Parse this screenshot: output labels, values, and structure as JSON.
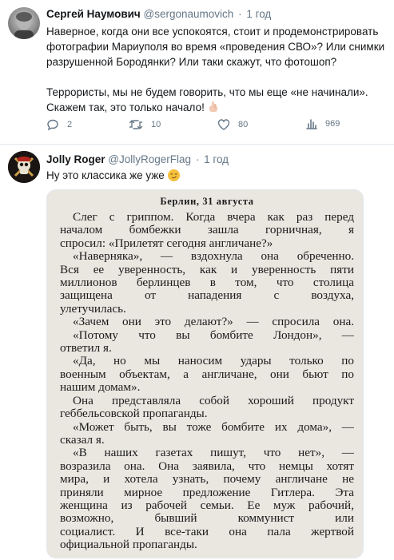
{
  "tweet1": {
    "name": "Сергей Наумович",
    "handle": "@sergonaumovich",
    "separator": "·",
    "time": "1 год",
    "text_lines": [
      "Наверное, когда они все успокоятся, стоит и продемонстрировать",
      "фотографии Мариуполя во время «проведения СВО»? Или снимки",
      "разрушенной Бородянки? Или таки скажут, что фотошоп?",
      "",
      "Террористы, мы не будем говорить, что мы еще «не начинали».",
      "Скажем так, это только начало!"
    ],
    "emoji_icon": "raised-hand-emoji",
    "actions": {
      "replies": "2",
      "retweets": "10",
      "likes": "80",
      "views": "969"
    }
  },
  "tweet2": {
    "name": "Jolly Roger",
    "handle": "@JollyRogerFlag",
    "separator": "·",
    "time": "1 год",
    "text": "Ну это классика же уже",
    "emoji_icon": "smirking-face-emoji",
    "book_page": {
      "heading": "Берлин, 31 августа",
      "lines": [
        "Слег с гриппом. Когда вчера как раз перед",
        "началом бомбежки зашла горничная, я",
        "спросил: «Прилетят сегодня англичане?»",
        "«Наверняка», — вздохнула она обреченно.",
        "Вся ее уверенность, как и уверенность пяти",
        "миллионов берлинцев в том, что столица",
        "защищена от нападения с воздуха,",
        "улетучилась.",
        "«Зачем они это делают?» — спросила она.",
        "«Потому что вы бомбите Лондон», —",
        "ответил я.",
        "«Да, но мы наносим удары только по",
        "военным объектам, а англичане, они бьют по",
        "нашим домам».",
        "Она представляла собой хороший продукт",
        "геббельсовской пропаганды.",
        "«Может быть, вы тоже бомбите их дома», —",
        "сказал я.",
        "«В наших газетах пишут, что нет», —",
        "возразила она. Она заявила, что немцы хотят",
        "мира, и хотела узнать, почему англичане не",
        "приняли мирное предложение Гитлера. Эта",
        "женщина из рабочей семьи. Ее муж рабочий,",
        "возможно, бывший коммунист или",
        "социалист. И все-таки она пала жертвой",
        "официальной пропаганды."
      ]
    }
  },
  "colors": {
    "text": "#14171a",
    "muted": "#657786",
    "divider": "#e1e8ed",
    "page": "#eae7e1"
  }
}
